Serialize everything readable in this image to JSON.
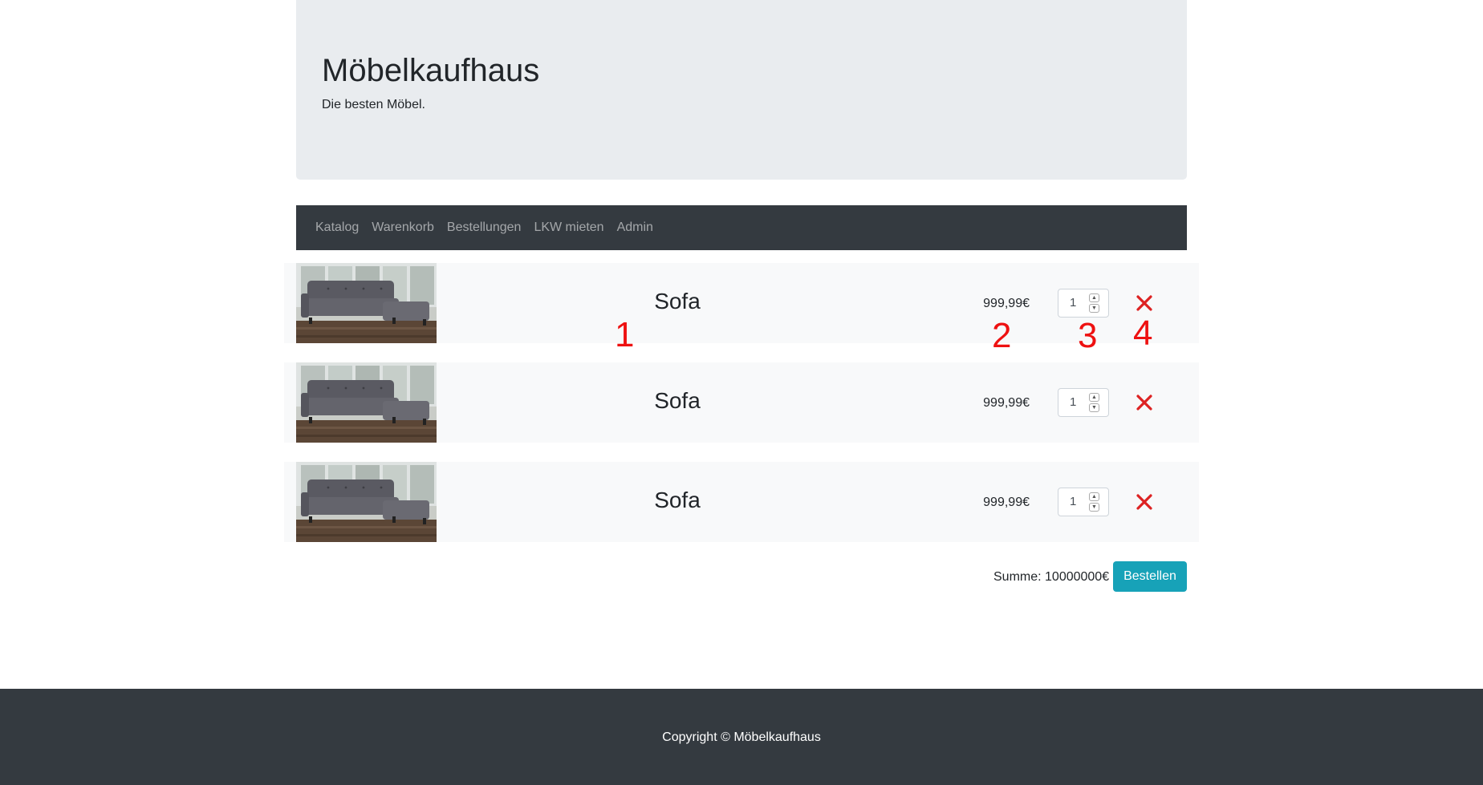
{
  "header": {
    "title": "Möbelkaufhaus",
    "subtitle": "Die besten Möbel."
  },
  "nav": {
    "items": [
      {
        "label": "Katalog"
      },
      {
        "label": "Warenkorb"
      },
      {
        "label": "Bestellungen"
      },
      {
        "label": "LKW mieten"
      },
      {
        "label": "Admin"
      }
    ]
  },
  "cart": {
    "items": [
      {
        "name": "Sofa",
        "price": "999,99€",
        "quantity": "1",
        "image": "sofa-image"
      },
      {
        "name": "Sofa",
        "price": "999,99€",
        "quantity": "1",
        "image": "sofa-image"
      },
      {
        "name": "Sofa",
        "price": "999,99€",
        "quantity": "1",
        "image": "sofa-image"
      }
    ],
    "summary": "Summe: 10000000€",
    "order_button": "Bestellen"
  },
  "annotations": [
    "1",
    "2",
    "3",
    "4"
  ],
  "footer": {
    "copyright": "Copyright © Möbelkaufhaus"
  },
  "colors": {
    "jumbotron_bg": "#e9ecef",
    "navbar_bg": "#343a40",
    "row_bg": "#f8f9fa",
    "remove_icon": "#dd2222",
    "order_button": "#17a2b8",
    "annotation": "#ee1111"
  }
}
